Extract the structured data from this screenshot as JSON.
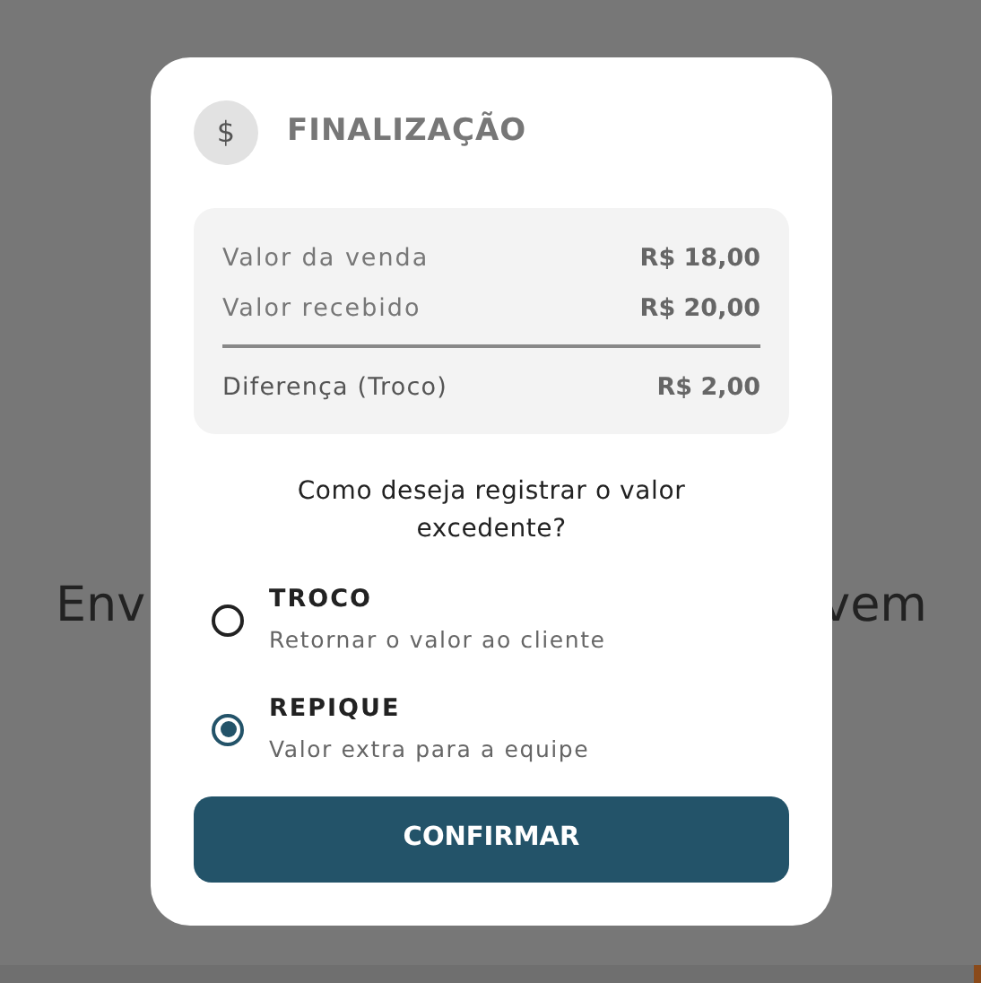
{
  "background": {
    "text_left": "Env",
    "text_right": "vem"
  },
  "modal": {
    "icon_glyph": "$",
    "title": "FINALIZAÇÃO",
    "summary": [
      {
        "label": "Valor da venda",
        "value": "R$ 18,00",
        "kind": "line"
      },
      {
        "label": "Valor recebido",
        "value": "R$ 20,00",
        "kind": "line"
      },
      {
        "label": "Diferença (Troco)",
        "value": "R$ 2,00",
        "kind": "total"
      }
    ],
    "question": "Como deseja registrar o valor excedente?",
    "options": [
      {
        "title": "TROCO",
        "subtitle": "Retornar o valor ao cliente",
        "selected": false
      },
      {
        "title": "REPIQUE",
        "subtitle": "Valor extra para a equipe",
        "selected": true
      }
    ],
    "confirm_button": "CONFIRMAR"
  }
}
